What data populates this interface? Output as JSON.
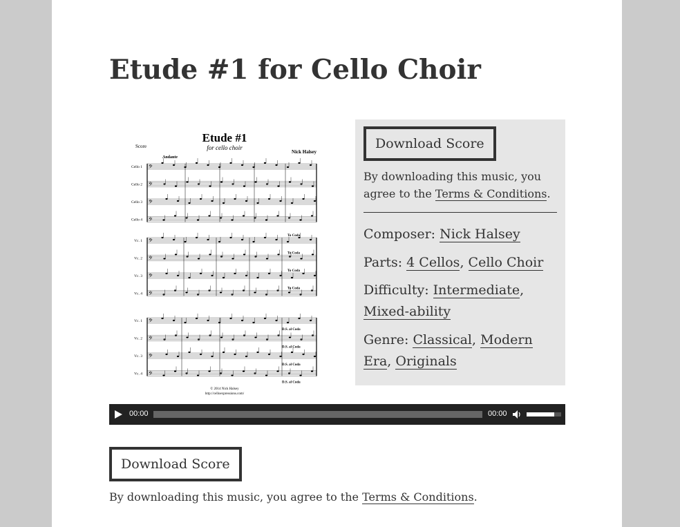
{
  "page": {
    "title": "Etude #1 for Cello Choir"
  },
  "score_image": {
    "alt": "Etude #1 score preview",
    "heading": "Etude #1",
    "subtitle": "for cello choir",
    "label": "Score",
    "composer": "Nick Halsey",
    "tempo": "Andante",
    "parts_system1": [
      "Cello 1",
      "Cello 2",
      "Cello 3",
      "Cello 4"
    ],
    "parts_system2": [
      "Vc. 1",
      "Vc. 2",
      "Vc. 3",
      "Vc. 4"
    ],
    "coda_label": "To Coda",
    "ds_label": "D.S. al Coda",
    "copyright": "© 2014 Nick Halsey",
    "url": "http://celloexpressions.com/"
  },
  "sidebar": {
    "download_label": "Download Score",
    "agree_text": "By downloading this music, you agree to the ",
    "terms_link": "Terms & Conditions",
    "agree_end": ".",
    "composer_label": "Composer: ",
    "composer": "Nick Halsey",
    "parts_label": "Parts: ",
    "parts": [
      "4 Cellos",
      "Cello Choir"
    ],
    "difficulty_label": "Difficulty: ",
    "difficulty": [
      "Intermediate",
      "Mixed-ability"
    ],
    "genre_label": "Genre: ",
    "genre": [
      "Classical",
      "Modern Era",
      "Originals"
    ],
    "separator": ", "
  },
  "player": {
    "current_time": "00:00",
    "duration": "00:00",
    "progress": 0,
    "volume": 0.8,
    "play_icon": "play-icon",
    "volume_icon": "speaker-icon"
  },
  "bottom": {
    "download_label": "Download Score",
    "agree_text": "By downloading this music, you agree to the ",
    "terms_link": "Terms & Conditions",
    "agree_end": "."
  }
}
